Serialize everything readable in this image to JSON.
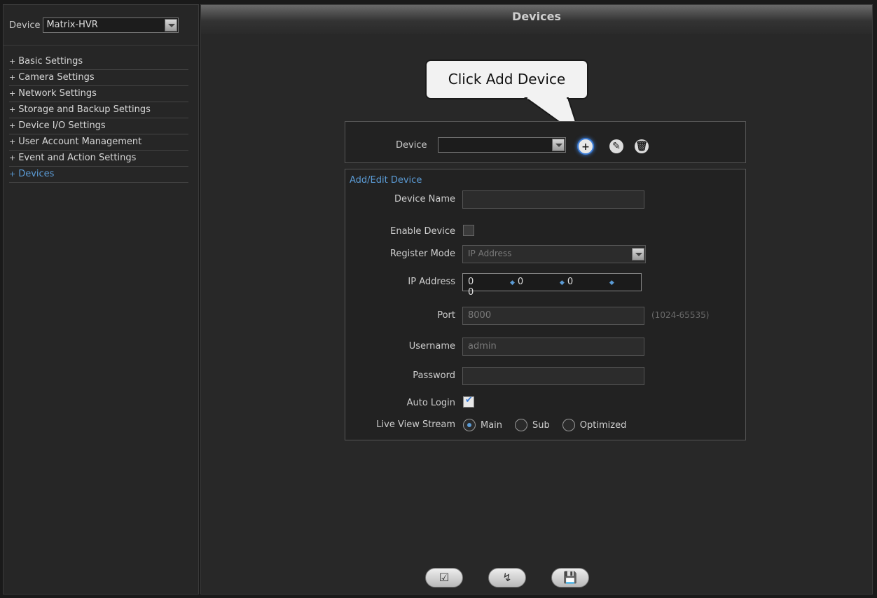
{
  "sidebar": {
    "device_label": "Device",
    "device_value": "Matrix-HVR",
    "menu": [
      {
        "label": "Basic Settings"
      },
      {
        "label": "Camera Settings"
      },
      {
        "label": "Network Settings"
      },
      {
        "label": "Storage and Backup Settings"
      },
      {
        "label": "Device I/O Settings"
      },
      {
        "label": "User Account Management"
      },
      {
        "label": "Event and Action Settings"
      },
      {
        "label": "Devices"
      }
    ],
    "menu_prefix": "+",
    "active_color": "#5b9bd5"
  },
  "main": {
    "title": "Devices",
    "callout": "Click Add Device",
    "device_row": {
      "label": "Device",
      "value": "",
      "add_icon": "add-circle-icon",
      "edit_icon": "edit-pencil-icon",
      "delete_icon": "delete-trash-icon"
    },
    "form": {
      "title": "Add/Edit Device",
      "device_name_label": "Device Name",
      "device_name_value": "",
      "enable_label": "Enable Device",
      "enable_checked": false,
      "register_label": "Register Mode",
      "register_value": "IP Address",
      "ip_label": "IP Address",
      "ip_octets": [
        "0",
        "0",
        "0",
        "0"
      ],
      "port_label": "Port",
      "port_value": "8000",
      "port_hint": "(1024-65535)",
      "username_label": "Username",
      "username_value": "admin",
      "password_label": "Password",
      "password_value": "",
      "autologin_label": "Auto Login",
      "autologin_checked": true,
      "stream_label": "Live View Stream",
      "stream_options": [
        "Main",
        "Sub",
        "Optimized"
      ],
      "stream_selected": "Main"
    },
    "bottom_buttons": [
      "apply-icon",
      "refresh-icon",
      "save-icon"
    ]
  }
}
